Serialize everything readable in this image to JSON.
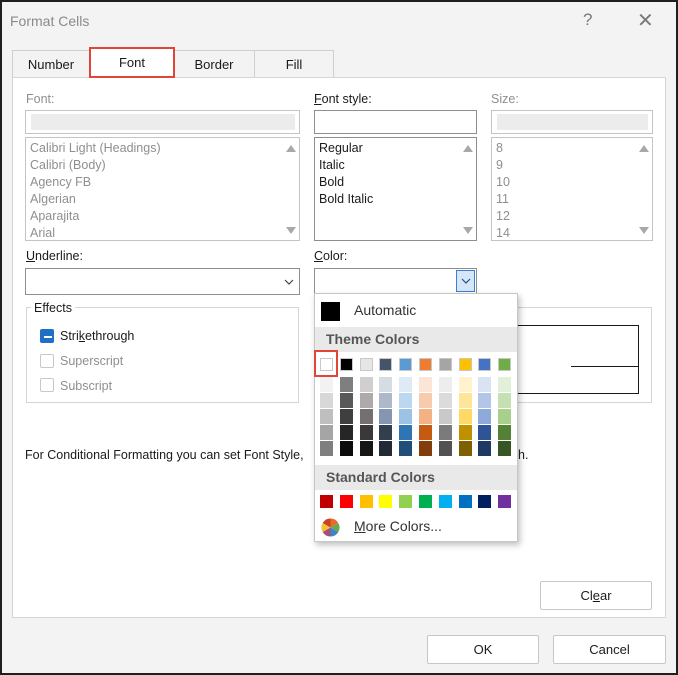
{
  "window": {
    "title": "Format Cells",
    "help_glyph": "?",
    "close_glyph": "✕"
  },
  "tabs": [
    {
      "label": "Number"
    },
    {
      "label": "Font"
    },
    {
      "label": "Border"
    },
    {
      "label": "Fill"
    }
  ],
  "font": {
    "label": "Font:",
    "items": [
      "Calibri Light (Headings)",
      "Calibri (Body)",
      "Agency FB",
      "Algerian",
      "Aparajita",
      "Arial"
    ]
  },
  "font_style": {
    "label_prefix": "F",
    "label_rest": "ont style:",
    "items": [
      "Regular",
      "Italic",
      "Bold",
      "Bold Italic"
    ]
  },
  "size": {
    "label": "Size:",
    "items": [
      "8",
      "9",
      "10",
      "11",
      "12",
      "14"
    ]
  },
  "underline": {
    "label_prefix": "U",
    "label_rest": "nderline:"
  },
  "color": {
    "label_prefix": "C",
    "label_rest": "olor:"
  },
  "effects": {
    "title": "Effects",
    "strikethrough_prefix": "Stri",
    "strikethrough_u": "k",
    "strikethrough_rest": "ethrough",
    "superscript": "Superscript",
    "subscript": "Subscript",
    "strikethrough_checked": true
  },
  "note": {
    "left": "For Conditional Formatting you can set Font Style,",
    "right": "h."
  },
  "buttons": {
    "clear_prefix": "Cl",
    "clear_u": "e",
    "clear_rest": "ar",
    "ok": "OK",
    "cancel": "Cancel"
  },
  "color_popup": {
    "automatic": "Automatic",
    "theme_header": "Theme Colors",
    "standard_header": "Standard Colors",
    "more_colors_prefix": "M",
    "more_colors_rest": "ore Colors...",
    "theme_top": [
      "#ffffff",
      "#000000",
      "#e7e6e6",
      "#44546a",
      "#5b9bd5",
      "#ed7d31",
      "#a5a5a5",
      "#ffc000",
      "#4472c4",
      "#70ad47"
    ],
    "theme_shades": [
      [
        "#f2f2f2",
        "#7f7f7f",
        "#d0cece",
        "#d6dce4",
        "#deebf6",
        "#fbe5d5",
        "#ededed",
        "#fff2cc",
        "#dae3f3",
        "#e2efd9"
      ],
      [
        "#d8d8d8",
        "#595959",
        "#aeaaaa",
        "#adb9ca",
        "#bdd7ee",
        "#f7cbac",
        "#dbdbdb",
        "#ffe598",
        "#b4c6e7",
        "#c5e0b3"
      ],
      [
        "#bfbfbf",
        "#3f3f3f",
        "#757070",
        "#8496b0",
        "#9cc3e5",
        "#f4b183",
        "#c9c9c9",
        "#ffd965",
        "#8eaadb",
        "#a8d08d"
      ],
      [
        "#a5a5a5",
        "#262626",
        "#3a3838",
        "#323f4f",
        "#2e75b5",
        "#c55a11",
        "#7b7b7b",
        "#bf9000",
        "#2f5496",
        "#538135"
      ],
      [
        "#7f7f7f",
        "#0c0c0c",
        "#171616",
        "#222a35",
        "#1e4e79",
        "#833c0b",
        "#525252",
        "#7f6000",
        "#1f3864",
        "#375623"
      ]
    ],
    "standard": [
      "#c00000",
      "#ff0000",
      "#ffc000",
      "#ffff00",
      "#92d050",
      "#00b050",
      "#00b0f0",
      "#0070c0",
      "#002060",
      "#7030a0"
    ],
    "selected_color": "#ffffff",
    "highlight_color": "#e0453a",
    "accent_color": "#1f6fc7"
  }
}
